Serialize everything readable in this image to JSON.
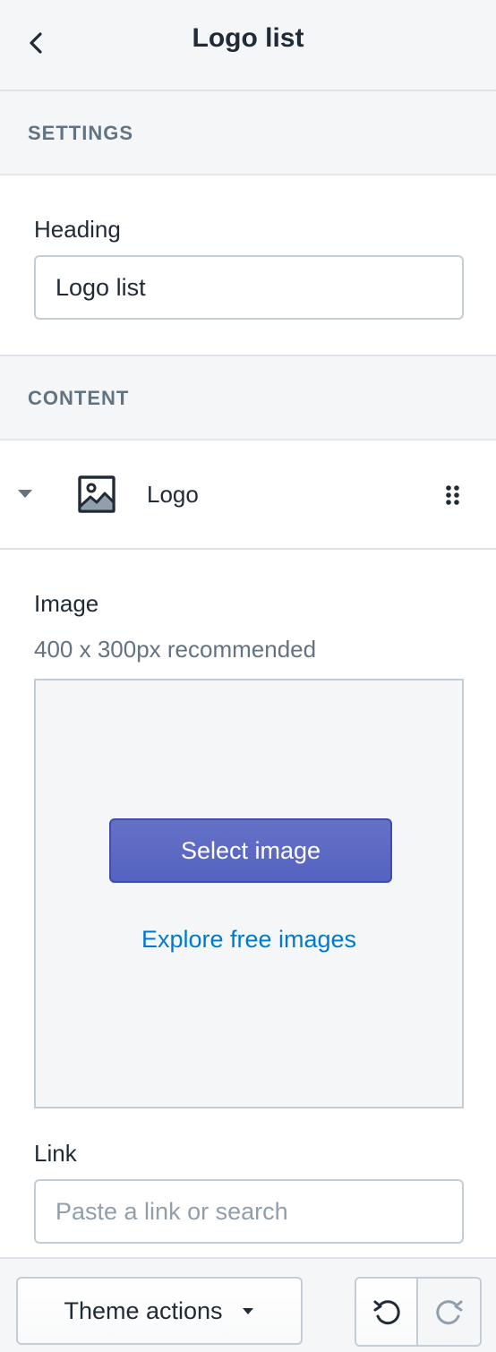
{
  "header": {
    "title": "Logo list",
    "back_icon": "chevron-left-icon"
  },
  "settings": {
    "section_label": "SETTINGS",
    "heading_label": "Heading",
    "heading_value": "Logo list"
  },
  "content": {
    "section_label": "CONTENT",
    "block": {
      "label": "Logo",
      "caret_icon": "caret-down-icon",
      "type_icon": "image-icon",
      "drag_icon": "drag-handle-icon"
    },
    "image": {
      "label": "Image",
      "help_text": "400 x 300px recommended",
      "select_button": "Select image",
      "explore_link": "Explore free images"
    },
    "link": {
      "label": "Link",
      "placeholder": "Paste a link or search",
      "value": ""
    }
  },
  "footer": {
    "theme_actions_label": "Theme actions",
    "undo_icon": "undo-icon",
    "redo_icon": "redo-icon"
  },
  "colors": {
    "primary": "#5c6ac4",
    "link": "#007ace",
    "subdued_text": "#637381",
    "panel_background": "#f4f6f8"
  }
}
